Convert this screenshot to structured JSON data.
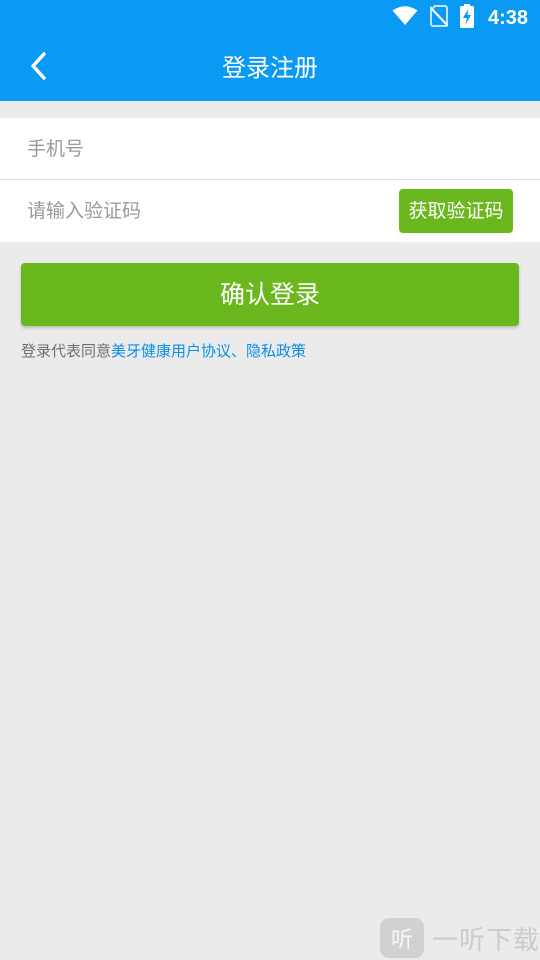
{
  "status_bar": {
    "time": "4:38",
    "icons": [
      "wifi-icon",
      "no-sim-icon",
      "battery-charging-icon"
    ]
  },
  "app_bar": {
    "title": "登录注册",
    "back_icon": "chevron-left-icon"
  },
  "form": {
    "phone_placeholder": "手机号",
    "code_placeholder": "请输入验证码",
    "get_code_label": "获取验证码"
  },
  "confirm_label": "确认登录",
  "agreement": {
    "prefix": "登录代表同意",
    "link_text": "美牙健康用户协议、隐私政策"
  },
  "watermark": {
    "logo_glyph": "听",
    "text": "一听下载"
  },
  "colors": {
    "primary": "#0a99f3",
    "accent_green": "#6ab81e",
    "link": "#0a8fe8",
    "background": "#ebebeb"
  }
}
